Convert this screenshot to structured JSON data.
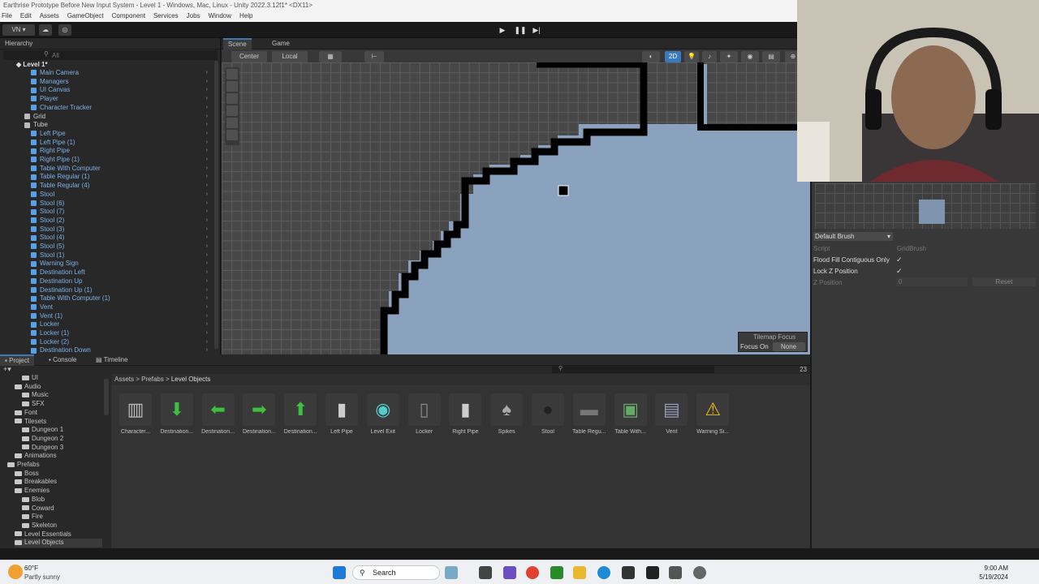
{
  "window": {
    "title": "Earthrise Prototype Before New Input System - Level 1 - Windows, Mac, Linux - Unity 2022.3.12f1* <DX11>"
  },
  "menu": [
    "File",
    "Edit",
    "Assets",
    "GameObject",
    "Component",
    "Services",
    "Jobs",
    "Window",
    "Help"
  ],
  "toolbar": {
    "account": "VN ▾"
  },
  "hierarchy": {
    "tab": "Hierarchy",
    "search_placeholder": "All",
    "scene_name": "Level 1*",
    "items": [
      "Main Camera",
      "Managers",
      "UI Canvas",
      "Player",
      "Character Tracker",
      "Grid",
      "Tube",
      "Left Pipe",
      "Left Pipe (1)",
      "Right Pipe",
      "Right Pipe (1)",
      "Table With Computer",
      "Table Regular (1)",
      "Table Regular (4)",
      "Stool",
      "Stool (6)",
      "Stool (7)",
      "Stool (2)",
      "Stool (3)",
      "Stool (4)",
      "Stool (5)",
      "Stool (1)",
      "Warning Sign",
      "Destination Left",
      "Destination Up",
      "Destination Up (1)",
      "Table With Computer (1)",
      "Vent",
      "Vent (1)",
      "Locker",
      "Locker (1)",
      "Locker (2)",
      "Destination Down"
    ]
  },
  "scene": {
    "tabs": [
      "Scene",
      "Game"
    ],
    "pivot": "Center",
    "space": "Local",
    "mode_2d": "2D",
    "tilemap_focus_title": "Tilemap Focus",
    "focus_on_label": "Focus On",
    "focus_on_value": "None"
  },
  "palette": {
    "brush": "Default Brush",
    "script_label": "Script",
    "script_value": "GridBrush",
    "flood_fill_label": "Flood Fill Contiguous Only",
    "lock_z_label": "Lock Z Position",
    "z_position_label": "Z Position",
    "z_position_value": "0",
    "reset": "Reset"
  },
  "project": {
    "tabs": [
      "Project",
      "Console",
      "Timeline"
    ],
    "breadcrumb": [
      "Assets",
      "Prefabs",
      "Level Objects"
    ],
    "count": "23",
    "tree": [
      {
        "label": "UI",
        "indent": 3
      },
      {
        "label": "Audio",
        "indent": 2
      },
      {
        "label": "Music",
        "indent": 3
      },
      {
        "label": "SFX",
        "indent": 3
      },
      {
        "label": "Font",
        "indent": 2
      },
      {
        "label": "Tilesets",
        "indent": 2
      },
      {
        "label": "Dungeon 1",
        "indent": 3
      },
      {
        "label": "Dungeon 2",
        "indent": 3
      },
      {
        "label": "Dungeon 3",
        "indent": 3
      },
      {
        "label": "Animations",
        "indent": 2
      },
      {
        "label": "Prefabs",
        "indent": 1
      },
      {
        "label": "Boss",
        "indent": 2
      },
      {
        "label": "Breakables",
        "indent": 2
      },
      {
        "label": "Enemies",
        "indent": 2
      },
      {
        "label": "Blob",
        "indent": 3
      },
      {
        "label": "Coward",
        "indent": 3
      },
      {
        "label": "Fire",
        "indent": 3
      },
      {
        "label": "Skeleton",
        "indent": 3
      },
      {
        "label": "Level Essentials",
        "indent": 2
      },
      {
        "label": "Level Objects",
        "indent": 2
      }
    ],
    "assets": [
      "Character...",
      "Destination...",
      "Destination...",
      "Destination...",
      "Destination...",
      "Left Pipe",
      "Level Exit",
      "Locker",
      "Right Pipe",
      "Spikes",
      "Stool",
      "Table Regu...",
      "Table With...",
      "Vent",
      "Warning Si..."
    ]
  },
  "taskbar": {
    "weather_temp": "60°F",
    "weather_desc": "Partly sunny",
    "search": "Search",
    "time": "9:00 AM",
    "date": "5/19/2024"
  },
  "colors": {
    "accent": "#3a79bb",
    "tile_fill": "#8aa2bd",
    "wall": "#000000",
    "hierarchy_text": "#7cb2e8"
  }
}
